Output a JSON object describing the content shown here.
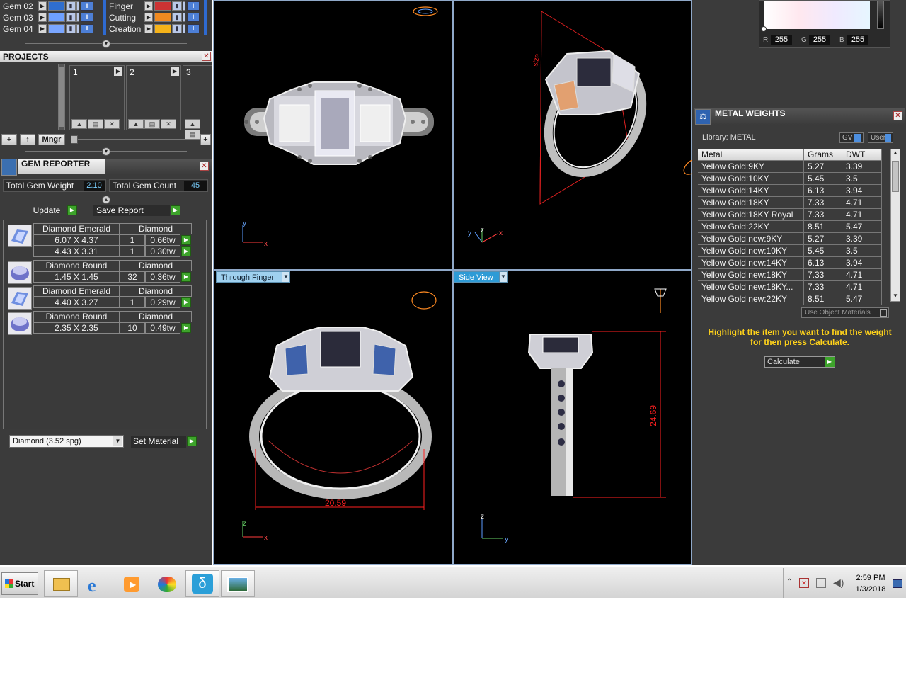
{
  "layers_left": [
    "Gem 02",
    "Gem 03",
    "Gem 04"
  ],
  "layers_right": [
    "Finger",
    "Cutting",
    "Creation"
  ],
  "layer_colors_left": [
    "#2f6ecf",
    "#6ea0ff",
    "#7aa6ff"
  ],
  "layer_colors_right": [
    "#cc3333",
    "#f08a20",
    "#f5b31a"
  ],
  "projects": {
    "title": "PROJECTS",
    "cards": [
      "1",
      "2",
      "3"
    ],
    "add_label": "+",
    "up_label": "↑",
    "mngr_label": "Mngr",
    "end_plus": "+"
  },
  "gem_reporter": {
    "title": "GEM REPORTER",
    "total_weight_label": "Total Gem Weight",
    "total_weight": "2.10",
    "total_count_label": "Total Gem Count",
    "total_count": "45",
    "update_label": "Update",
    "save_report_label": "Save Report",
    "items": [
      {
        "name": "Diamond Emerald",
        "material": "Diamond",
        "icon": "emerald-cut-gem-icon",
        "rows": [
          {
            "size": "6.07 X 4.37",
            "qty": "1",
            "weight": "0.66tw"
          },
          {
            "size": "4.43 X 3.31",
            "qty": "1",
            "weight": "0.30tw"
          }
        ]
      },
      {
        "name": "Diamond Round",
        "material": "Diamond",
        "icon": "round-gem-icon",
        "rows": [
          {
            "size": "1.45 X 1.45",
            "qty": "32",
            "weight": "0.36tw"
          }
        ]
      },
      {
        "name": "Diamond Emerald",
        "material": "Diamond",
        "icon": "emerald-cut-gem-icon",
        "rows": [
          {
            "size": "4.40 X 3.27",
            "qty": "1",
            "weight": "0.29tw"
          }
        ]
      },
      {
        "name": "Diamond Round",
        "material": "Diamond",
        "icon": "round-gem-icon",
        "rows": [
          {
            "size": "2.35 X 2.35",
            "qty": "10",
            "weight": "0.49tw"
          }
        ]
      }
    ],
    "material_select": "Diamond     (3.52 spg)",
    "set_material_label": "Set Material"
  },
  "viewports": {
    "bottom_left_tab": "Through Finger",
    "bottom_right_tab": "Side View",
    "top_left_axes": {
      "y": "y",
      "x": "x"
    },
    "top_right_axes": {
      "y": "y",
      "z": "z",
      "x": "x"
    },
    "bottom_left_axes": {
      "z": "z",
      "x": "x"
    },
    "bottom_right_axes": {
      "z": "z",
      "y": "y"
    },
    "dimension_width": "20.59",
    "dimension_height": "24.69",
    "dimension_small": "size"
  },
  "color_picker": {
    "r_label": "R",
    "r": "255",
    "g_label": "G",
    "g": "255",
    "b_label": "B",
    "b": "255"
  },
  "metal_weights": {
    "title": "METAL WEIGHTS",
    "library_label": "Library: METAL",
    "gv_label": "GV",
    "user_label": "User",
    "columns": [
      "Metal",
      "Grams",
      "DWT"
    ],
    "rows": [
      [
        "Yellow Gold:9KY",
        "5.27",
        "3.39"
      ],
      [
        "Yellow Gold:10KY",
        "5.45",
        "3.5"
      ],
      [
        "Yellow Gold:14KY",
        "6.13",
        "3.94"
      ],
      [
        "Yellow Gold:18KY",
        "7.33",
        "4.71"
      ],
      [
        "Yellow Gold:18KY Royal",
        "7.33",
        "4.71"
      ],
      [
        "Yellow Gold:22KY",
        "8.51",
        "5.47"
      ],
      [
        "Yellow Gold new:9KY",
        "5.27",
        "3.39"
      ],
      [
        "Yellow Gold new:10KY",
        "5.45",
        "3.5"
      ],
      [
        "Yellow Gold new:14KY",
        "6.13",
        "3.94"
      ],
      [
        "Yellow Gold new:18KY",
        "7.33",
        "4.71"
      ],
      [
        "Yellow Gold new:18KY...",
        "7.33",
        "4.71"
      ],
      [
        "Yellow Gold new:22KY",
        "8.51",
        "5.47"
      ]
    ],
    "use_object_materials": "Use Object Materials",
    "hint_line1": "Highlight the item you want to find the weight",
    "hint_line2": "for then press Calculate.",
    "calculate_label": "Calculate"
  },
  "taskbar": {
    "start_label": "Start",
    "apps": [
      "file-explorer-icon",
      "internet-explorer-icon",
      "media-player-icon",
      "paint-icon",
      "matrix-app-icon",
      "picture-viewer-icon"
    ],
    "time": "2:59 PM",
    "date": "1/3/2018"
  }
}
